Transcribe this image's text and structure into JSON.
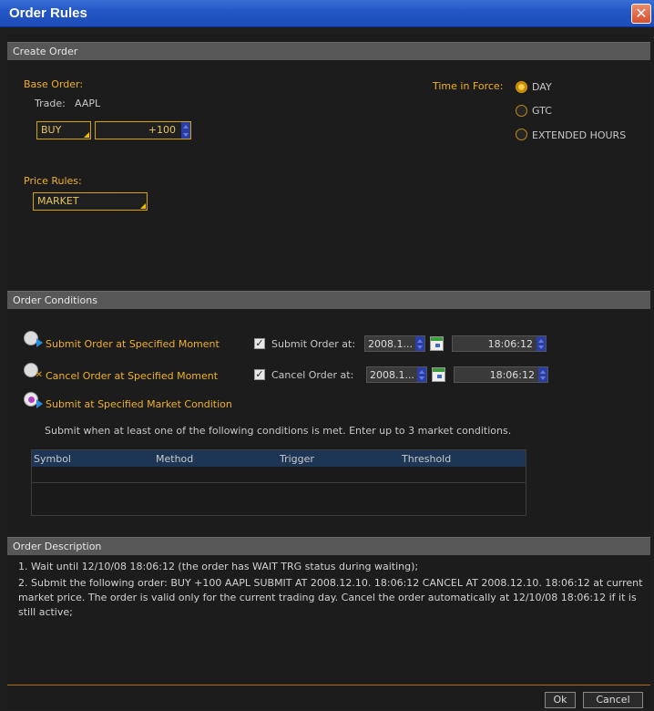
{
  "window": {
    "title": "Order Rules",
    "close_symbol": "✕"
  },
  "create_order": {
    "header": "Create Order",
    "base_order_label": "Base Order:",
    "trade_label": "Trade:",
    "trade_symbol": "AAPL",
    "side": "BUY",
    "quantity": "+100",
    "time_in_force_label": "Time in Force:",
    "tif_options": [
      {
        "label": "DAY",
        "selected": true
      },
      {
        "label": "GTC",
        "selected": false
      },
      {
        "label": "EXTENDED HOURS",
        "selected": false
      }
    ],
    "price_rules_label": "Price Rules:",
    "price_rule": "MARKET"
  },
  "order_conditions": {
    "header": "Order Conditions",
    "submit_condition_label": "Submit Order at Specified Moment",
    "cancel_condition_label": "Cancel Order at Specified Moment",
    "market_condition_label": "Submit at Specified Market Condition",
    "submit_checkbox_label": "Submit Order at:",
    "cancel_checkbox_label": "Cancel Order at:",
    "submit_date": "2008.1...",
    "submit_time": "18:06:12",
    "cancel_date": "2008.1...",
    "cancel_time": "18:06:12",
    "checkmark": "✓",
    "market_instruction": "Submit when at least one of the following conditions is met. Enter up to 3 market conditions.",
    "table_columns": [
      "Symbol",
      "Method",
      "Trigger",
      "Threshold"
    ]
  },
  "order_description": {
    "header": "Order Description",
    "line1": "1.  Wait until 12/10/08 18:06:12 (the order has WAIT TRG status during waiting);",
    "line2": "2.  Submit the following order: BUY +100 AAPL SUBMIT AT 2008.12.10. 18:06:12 CANCEL AT 2008.12.10. 18:06:12 at current market price. The order is valid only for the current trading day. Cancel the order automatically at 12/10/08 18:06:12 if it is still active;"
  },
  "buttons": {
    "ok": "Ok",
    "cancel": "Cancel"
  },
  "colors": {
    "accent": "#f0b028",
    "title_bar": "#2457c6",
    "section_header": "#575757"
  }
}
